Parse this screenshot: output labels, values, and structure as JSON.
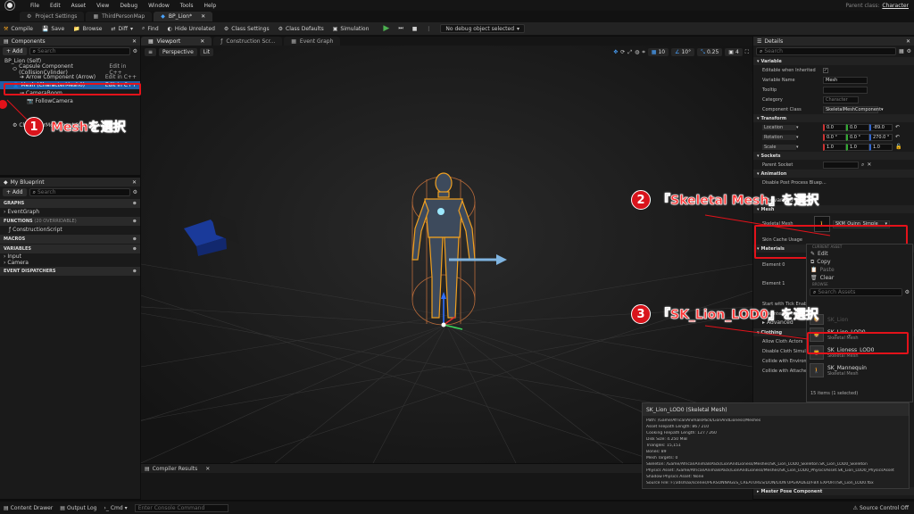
{
  "menu": [
    "File",
    "Edit",
    "Asset",
    "View",
    "Debug",
    "Window",
    "Tools",
    "Help"
  ],
  "parent_class_label": "Parent class:",
  "parent_class_value": "Character",
  "tabs": [
    {
      "label": "Project Settings",
      "active": false
    },
    {
      "label": "ThirdPersonMap",
      "active": false
    },
    {
      "label": "BP_Lion*",
      "active": true
    }
  ],
  "toolbar": {
    "compile": "Compile",
    "save": "Save",
    "browse": "Browse",
    "diff": "Diff",
    "find": "Find",
    "hide_unrelated": "Hide Unrelated",
    "class_settings": "Class Settings",
    "class_defaults": "Class Defaults",
    "simulation": "Simulation",
    "debug_select": "No debug object selected"
  },
  "components": {
    "title": "Components",
    "add": "+ Add",
    "search_placeholder": "Search",
    "items": [
      {
        "label": "BP_Lion (Self)",
        "action": ""
      },
      {
        "label": "Capsule Component (CollisionCylinder)",
        "action": "Edit in C++"
      },
      {
        "label": "Arrow Component (Arrow)",
        "action": "Edit in C++"
      },
      {
        "label": "Mesh (CharacterMesh0)",
        "action": "Edit in C++"
      },
      {
        "label": "CameraBoom",
        "action": ""
      },
      {
        "label": "FollowCamera",
        "action": ""
      },
      {
        "label": "CharacterMovement (CharMoveComp)",
        "action": ""
      }
    ]
  },
  "my_blueprint": {
    "title": "My Blueprint",
    "add": "+ Add",
    "search_placeholder": "Search",
    "graphs": "GRAPHS",
    "event_graph": "EventGraph",
    "functions": "FUNCTIONS",
    "functions_note": "(20 OVERRIDABLE)",
    "construction_script": "ConstructionScript",
    "macros": "MACROS",
    "variables": "VARIABLES",
    "var_input": "Input",
    "var_camera": "Camera",
    "event_dispatchers": "EVENT DISPATCHERS"
  },
  "viewport": {
    "tabs": [
      "Viewport",
      "Construction Scr...",
      "Event Graph"
    ],
    "perspective": "Perspective",
    "lit": "Lit",
    "snap_values": [
      "10",
      "10°",
      "0.25",
      "4"
    ]
  },
  "compiler_results": "Compiler Results",
  "details": {
    "title": "Details",
    "search_placeholder": "Search",
    "variable_section": "Variable",
    "editable_label": "Editable when Inherited",
    "variable_name_label": "Variable Name",
    "variable_name_value": "Mesh",
    "tooltip_label": "Tooltip",
    "category_label": "Category",
    "category_value": "Character",
    "component_class_label": "Component Class",
    "component_class_value": "SkeletalMeshComponent",
    "transform_section": "Transform",
    "location_label": "Location",
    "location": [
      "0.0",
      "0.0",
      "-89.0"
    ],
    "rotation_label": "Rotation",
    "rotation": [
      "0.0 °",
      "0.0 °",
      "270.0 °"
    ],
    "scale_label": "Scale",
    "scale": [
      "1.0",
      "1.0",
      "1.0"
    ],
    "sockets_section": "Sockets",
    "parent_socket_label": "Parent Socket",
    "animation_section": "Animation",
    "disable_post_label": "Disable Post Process Bluep...",
    "advanced_label": "Advanced",
    "mesh_section": "Mesh",
    "skeletal_mesh_label": "Skeletal Mesh",
    "skeletal_mesh_value": "SKM_Quinn_Simple",
    "skin_cache_label": "Skin Cache Usage",
    "materials_section": "Materials",
    "element0_label": "Element 0",
    "element1_label": "Element 1",
    "start_tick_label": "Start with Tick Enabled",
    "tick_interval_label": "Tick Interval (secs)",
    "advanced2_label": "Advanced",
    "clothing_section": "Clothing",
    "allow_cloth_label": "Allow Cloth Actors",
    "disable_cloth_label": "Disable Cloth Simulation",
    "collide_env_label": "Collide with Environment",
    "collide_attached_label": "Collide with Attached Chi...",
    "bottom_section": "Master Pose Component"
  },
  "asset_dropdown": {
    "current_asset_label": "CURRENT ASSET",
    "edit": "Edit",
    "copy": "Copy",
    "paste": "Paste",
    "clear": "Clear",
    "browse_label": "BROWSE",
    "search_placeholder": "Search Assets",
    "items": [
      {
        "name": "SK_Lion",
        "type": "Skeletal Mesh"
      },
      {
        "name": "SK_Lion_LOD0",
        "type": "Skeletal Mesh"
      },
      {
        "name": "SK_Lioness_LOD0",
        "type": "Skeletal Mesh"
      },
      {
        "name": "SK_Mannequin",
        "type": "Skeletal Mesh"
      }
    ],
    "count": "15 items (1 selected)"
  },
  "tooltip": {
    "title": "SK_Lion_LOD0 (Skeletal Mesh)",
    "lines": [
      "Path: /Game/AfricanAnimalsPack/LionAndLioness/Meshes",
      "Asset Filepath Length: 86 / 210",
      "Cooking Filepath Length: 127 / 260",
      "Disk Size: 4.250 MiB",
      "Triangles: 15,151",
      "Bones: 89",
      "Mesh Targets: 0",
      "Skeleton: /Game/AfricanAnimalsPack/LionAndLioness/Meshes/SK_Lion_LOD0_Skeleton.SK_Lion_LOD0_Skeleton",
      "Physics Asset: /Game/AfricanAnimalsPack/LionAndLioness/Meshes/SK_Lion_LOD0_PhysicsAsset.SK_Lion_LOD0_PhysicsAsset",
      "Shadow Physics Asset: None",
      "Source File: F:/3dsmax/scenes/PERSONNAGES_CREATURES/LION/LION UPGRADED/FBX EXPORT/SK_Lion_LOD0.fbx"
    ]
  },
  "statusbar": {
    "content_drawer": "Content Drawer",
    "output_log": "Output Log",
    "cmd": "Cmd",
    "console_placeholder": "Enter Console Command",
    "source_control": "Source Control Off"
  },
  "callouts": [
    {
      "num": "1",
      "text": "Meshを選択"
    },
    {
      "num": "2",
      "text": "『Skeletal Mesh』を選択"
    },
    {
      "num": "3",
      "text": "『SK_Lion_LOD0』を選択"
    }
  ],
  "colors": {
    "highlight_red": "#e3121a",
    "selection_blue": "#1f5fa8",
    "accent_yellow": "#f0a020"
  }
}
